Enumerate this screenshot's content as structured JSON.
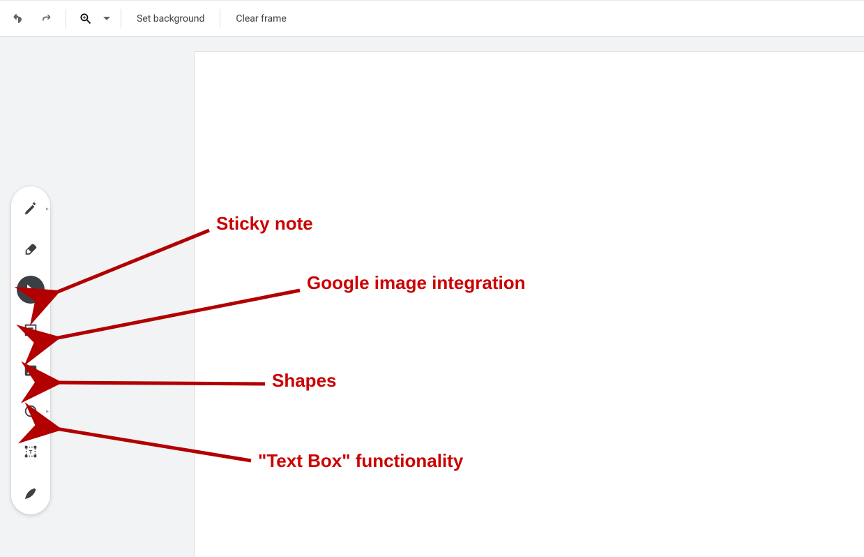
{
  "topbar": {
    "undo_label": "Undo",
    "redo_label": "Redo",
    "zoom_label": "Zoom",
    "set_background_label": "Set background",
    "clear_frame_label": "Clear frame"
  },
  "tools": {
    "pen_label": "Pen",
    "eraser_label": "Eraser",
    "select_label": "Select",
    "sticky_note_label": "Sticky note",
    "image_label": "Add image",
    "shape_label": "Shape",
    "text_box_label": "Text box",
    "laser_label": "Laser"
  },
  "annotations": {
    "sticky_note": "Sticky note",
    "google_image": "Google image integration",
    "shapes": "Shapes",
    "text_box": "\"Text Box\" functionality"
  }
}
